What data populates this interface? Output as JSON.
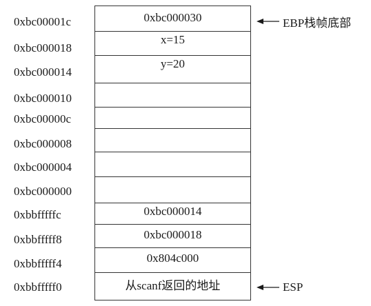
{
  "rows": [
    {
      "address": "0xbc00001c",
      "value": "0xbc000030"
    },
    {
      "address": "0xbc000018",
      "value": "x=15"
    },
    {
      "address": "0xbc000014",
      "value": "y=20"
    },
    {
      "address": "0xbc000010",
      "value": ""
    },
    {
      "address": "0xbc00000c",
      "value": ""
    },
    {
      "address": "0xbc000008",
      "value": ""
    },
    {
      "address": "0xbc000004",
      "value": ""
    },
    {
      "address": "0xbc000000",
      "value": ""
    },
    {
      "address": "0xbbfffffc",
      "value": "0xbc000014"
    },
    {
      "address": "0xbbfffff8",
      "value": "0xbc000018"
    },
    {
      "address": "0xbbfffff4",
      "value": "0x804c000"
    },
    {
      "address": "0xbbfffff0",
      "value": "从scanf返回的地址"
    }
  ],
  "annotations": {
    "ebp_label": "EBP栈帧底部",
    "esp_label": "ESP"
  }
}
